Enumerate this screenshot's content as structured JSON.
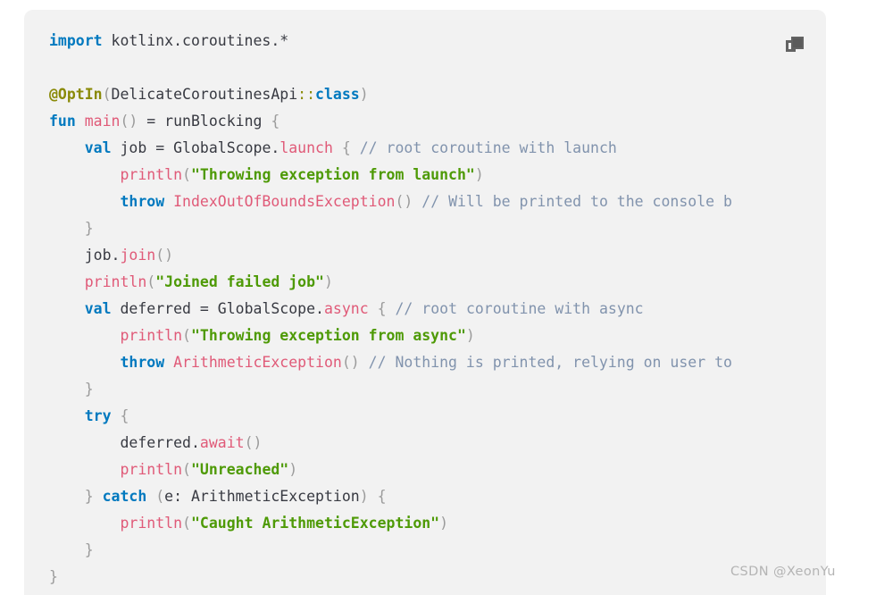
{
  "card": {
    "language": "kotlin",
    "background_color": "#f2f2f2",
    "page_background_color": "#ffffff"
  },
  "toolbar": {
    "copy_icon_name": "copy-icon",
    "copy_icon_title": "copy"
  },
  "watermark": {
    "text": "CSDN @XeonYu"
  },
  "theme": {
    "keyword_color": "#0079bf",
    "function_color": "#e05a78",
    "string_color": "#4e9a06",
    "comment_color": "#8193ad",
    "punctuation_color": "#9b9b9b",
    "annotation_color": "#8a8a08",
    "plain_color": "#383a42"
  },
  "code": {
    "plain_text": "import kotlinx.coroutines.*\n\n@OptIn(DelicateCoroutinesApi::class)\nfun main() = runBlocking {\n    val job = GlobalScope.launch { // root coroutine with launch\n        println(\"Throwing exception from launch\")\n        throw IndexOutOfBoundsException() // Will be printed to the console b\n    }\n    job.join()\n    println(\"Joined failed job\")\n    val deferred = GlobalScope.async { // root coroutine with async\n        println(\"Throwing exception from async\")\n        throw ArithmeticException() // Nothing is printed, relying on user to\n    }\n    try {\n        deferred.await()\n        println(\"Unreached\")\n    } catch (e: ArithmeticException) {\n        println(\"Caught ArithmeticException\")\n    }\n}",
    "lines": [
      {
        "n": 1,
        "tokens": [
          {
            "t": "import",
            "c": "kw"
          },
          {
            "t": " kotlinx.coroutines.*",
            "c": "plain"
          }
        ]
      },
      {
        "n": 2,
        "tokens": []
      },
      {
        "n": 3,
        "tokens": [
          {
            "t": "@OptIn",
            "c": "ann"
          },
          {
            "t": "(",
            "c": "punc"
          },
          {
            "t": "DelicateCoroutinesApi",
            "c": "plain"
          },
          {
            "t": "::",
            "c": "coloncolon"
          },
          {
            "t": "class",
            "c": "kw"
          },
          {
            "t": ")",
            "c": "punc"
          }
        ]
      },
      {
        "n": 4,
        "tokens": [
          {
            "t": "fun",
            "c": "kw"
          },
          {
            "t": " ",
            "c": "plain"
          },
          {
            "t": "main",
            "c": "fn"
          },
          {
            "t": "()",
            "c": "punc"
          },
          {
            "t": " = runBlocking ",
            "c": "plain"
          },
          {
            "t": "{",
            "c": "punc"
          }
        ]
      },
      {
        "n": 5,
        "tokens": [
          {
            "t": "    ",
            "c": "plain"
          },
          {
            "t": "val",
            "c": "kw"
          },
          {
            "t": " job = GlobalScope.",
            "c": "plain"
          },
          {
            "t": "launch",
            "c": "fn"
          },
          {
            "t": " ",
            "c": "plain"
          },
          {
            "t": "{",
            "c": "punc"
          },
          {
            "t": " ",
            "c": "plain"
          },
          {
            "t": "// root coroutine with launch",
            "c": "cmt"
          }
        ]
      },
      {
        "n": 6,
        "tokens": [
          {
            "t": "        ",
            "c": "plain"
          },
          {
            "t": "println",
            "c": "fn"
          },
          {
            "t": "(",
            "c": "punc"
          },
          {
            "t": "\"Throwing exception from launch\"",
            "c": "str"
          },
          {
            "t": ")",
            "c": "punc"
          }
        ]
      },
      {
        "n": 7,
        "tokens": [
          {
            "t": "        ",
            "c": "plain"
          },
          {
            "t": "throw",
            "c": "kw"
          },
          {
            "t": " ",
            "c": "plain"
          },
          {
            "t": "IndexOutOfBoundsException",
            "c": "type"
          },
          {
            "t": "()",
            "c": "punc"
          },
          {
            "t": " ",
            "c": "plain"
          },
          {
            "t": "// Will be printed to the console b",
            "c": "cmt"
          }
        ]
      },
      {
        "n": 8,
        "tokens": [
          {
            "t": "    ",
            "c": "plain"
          },
          {
            "t": "}",
            "c": "punc"
          }
        ]
      },
      {
        "n": 9,
        "tokens": [
          {
            "t": "    job.",
            "c": "plain"
          },
          {
            "t": "join",
            "c": "fn"
          },
          {
            "t": "()",
            "c": "punc"
          }
        ]
      },
      {
        "n": 10,
        "tokens": [
          {
            "t": "    ",
            "c": "plain"
          },
          {
            "t": "println",
            "c": "fn"
          },
          {
            "t": "(",
            "c": "punc"
          },
          {
            "t": "\"Joined failed job\"",
            "c": "str"
          },
          {
            "t": ")",
            "c": "punc"
          }
        ]
      },
      {
        "n": 11,
        "tokens": [
          {
            "t": "    ",
            "c": "plain"
          },
          {
            "t": "val",
            "c": "kw"
          },
          {
            "t": " deferred = GlobalScope.",
            "c": "plain"
          },
          {
            "t": "async",
            "c": "fn"
          },
          {
            "t": " ",
            "c": "plain"
          },
          {
            "t": "{",
            "c": "punc"
          },
          {
            "t": " ",
            "c": "plain"
          },
          {
            "t": "// root coroutine with async",
            "c": "cmt"
          }
        ]
      },
      {
        "n": 12,
        "tokens": [
          {
            "t": "        ",
            "c": "plain"
          },
          {
            "t": "println",
            "c": "fn"
          },
          {
            "t": "(",
            "c": "punc"
          },
          {
            "t": "\"Throwing exception from async\"",
            "c": "str"
          },
          {
            "t": ")",
            "c": "punc"
          }
        ]
      },
      {
        "n": 13,
        "tokens": [
          {
            "t": "        ",
            "c": "plain"
          },
          {
            "t": "throw",
            "c": "kw"
          },
          {
            "t": " ",
            "c": "plain"
          },
          {
            "t": "ArithmeticException",
            "c": "type"
          },
          {
            "t": "()",
            "c": "punc"
          },
          {
            "t": " ",
            "c": "plain"
          },
          {
            "t": "// Nothing is printed, relying on user to",
            "c": "cmt"
          }
        ]
      },
      {
        "n": 14,
        "tokens": [
          {
            "t": "    ",
            "c": "plain"
          },
          {
            "t": "}",
            "c": "punc"
          }
        ]
      },
      {
        "n": 15,
        "tokens": [
          {
            "t": "    ",
            "c": "plain"
          },
          {
            "t": "try",
            "c": "kw"
          },
          {
            "t": " ",
            "c": "plain"
          },
          {
            "t": "{",
            "c": "punc"
          }
        ]
      },
      {
        "n": 16,
        "tokens": [
          {
            "t": "        deferred.",
            "c": "plain"
          },
          {
            "t": "await",
            "c": "fn"
          },
          {
            "t": "()",
            "c": "punc"
          }
        ]
      },
      {
        "n": 17,
        "tokens": [
          {
            "t": "        ",
            "c": "plain"
          },
          {
            "t": "println",
            "c": "fn"
          },
          {
            "t": "(",
            "c": "punc"
          },
          {
            "t": "\"Unreached\"",
            "c": "str"
          },
          {
            "t": ")",
            "c": "punc"
          }
        ]
      },
      {
        "n": 18,
        "tokens": [
          {
            "t": "    ",
            "c": "plain"
          },
          {
            "t": "}",
            "c": "punc"
          },
          {
            "t": " ",
            "c": "plain"
          },
          {
            "t": "catch",
            "c": "kw"
          },
          {
            "t": " ",
            "c": "plain"
          },
          {
            "t": "(",
            "c": "punc"
          },
          {
            "t": "e: ArithmeticException",
            "c": "plain"
          },
          {
            "t": ")",
            "c": "punc"
          },
          {
            "t": " ",
            "c": "plain"
          },
          {
            "t": "{",
            "c": "punc"
          }
        ]
      },
      {
        "n": 19,
        "tokens": [
          {
            "t": "        ",
            "c": "plain"
          },
          {
            "t": "println",
            "c": "fn"
          },
          {
            "t": "(",
            "c": "punc"
          },
          {
            "t": "\"Caught ArithmeticException\"",
            "c": "str"
          },
          {
            "t": ")",
            "c": "punc"
          }
        ]
      },
      {
        "n": 20,
        "tokens": [
          {
            "t": "    ",
            "c": "plain"
          },
          {
            "t": "}",
            "c": "punc"
          }
        ]
      },
      {
        "n": 21,
        "tokens": [
          {
            "t": "}",
            "c": "punc"
          }
        ]
      }
    ]
  }
}
